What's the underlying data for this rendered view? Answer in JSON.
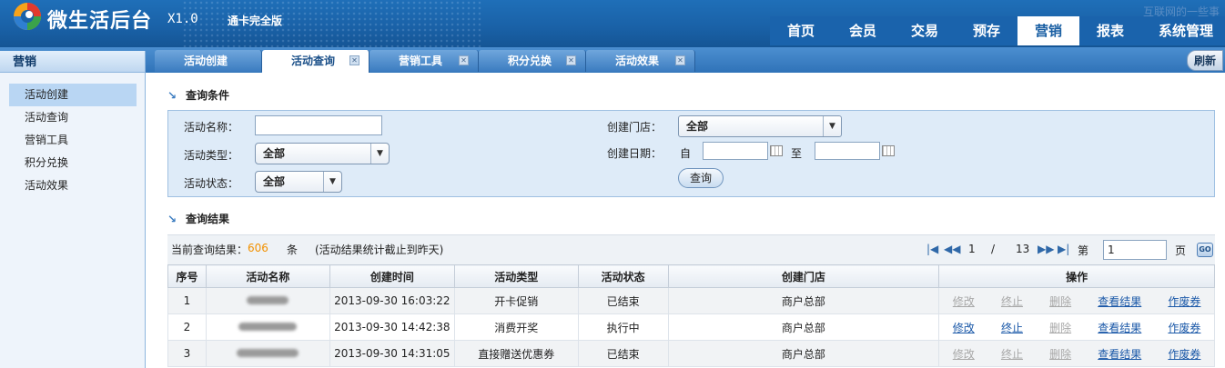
{
  "header": {
    "app_title": "微生活后台",
    "version": "X1.0",
    "edition": "通卡完全版",
    "brand_right": "互联网的一些事",
    "nav": [
      "首页",
      "会员",
      "交易",
      "预存",
      "营销",
      "报表",
      "系统管理"
    ],
    "active_nav": "营销"
  },
  "sidebar": {
    "title": "营销",
    "items": [
      "活动创建",
      "活动查询",
      "营销工具",
      "积分兑换",
      "活动效果"
    ],
    "active_item": "活动创建"
  },
  "tabs": {
    "items": [
      "活动创建",
      "活动查询",
      "营销工具",
      "积分兑换",
      "活动效果"
    ],
    "active": "活动查询",
    "refresh_label": "刷新"
  },
  "query": {
    "section_title": "查询条件",
    "name_label": "活动名称：",
    "name_value": "",
    "type_label": "活动类型：",
    "type_value": "全部",
    "status_label": "活动状态：",
    "status_value": "全部",
    "store_label": "创建门店：",
    "store_value": "全部",
    "date_label": "创建日期：",
    "date_from_label": "自",
    "date_to_label": "至",
    "button_label": "查询"
  },
  "results": {
    "section_title": "查询结果",
    "count_prefix": "当前查询结果：",
    "count": "606",
    "count_suffix": "条",
    "count_note": "(活动结果统计截止到昨天)",
    "page_current": "1",
    "page_sep": "/",
    "page_total": "13",
    "page_prefix": "第",
    "page_input": "1",
    "page_suffix": "页",
    "go_label": "GO",
    "columns": [
      "序号",
      "活动名称",
      "创建时间",
      "活动类型",
      "活动状态",
      "创建门店",
      "操作"
    ],
    "rows": [
      {
        "no": "1",
        "created": "2013-09-30 16:03:22",
        "type": "开卡促销",
        "status": "已结束",
        "status_kind": "ended",
        "store": "商户总部",
        "ops": [
          "修改",
          "终止",
          "删除",
          "查看结果",
          "作废券"
        ],
        "ops_enabled": [
          false,
          false,
          false,
          true,
          true
        ]
      },
      {
        "no": "2",
        "created": "2013-09-30 14:42:38",
        "type": "消费开奖",
        "status": "执行中",
        "status_kind": "running",
        "store": "商户总部",
        "ops": [
          "修改",
          "终止",
          "删除",
          "查看结果",
          "作废券"
        ],
        "ops_enabled": [
          true,
          true,
          false,
          true,
          true
        ]
      },
      {
        "no": "3",
        "created": "2013-09-30 14:31:05",
        "type": "直接赠送优惠券",
        "status": "已结束",
        "status_kind": "ended",
        "store": "商户总部",
        "ops": [
          "修改",
          "终止",
          "删除",
          "查看结果",
          "作废券"
        ],
        "ops_enabled": [
          false,
          false,
          false,
          true,
          true
        ]
      }
    ]
  },
  "colors": {
    "header_blue": "#1a62a8",
    "status_ended": "#cc0000",
    "status_running": "#149b14",
    "link": "#1a58a8",
    "count_orange": "#f29100"
  }
}
